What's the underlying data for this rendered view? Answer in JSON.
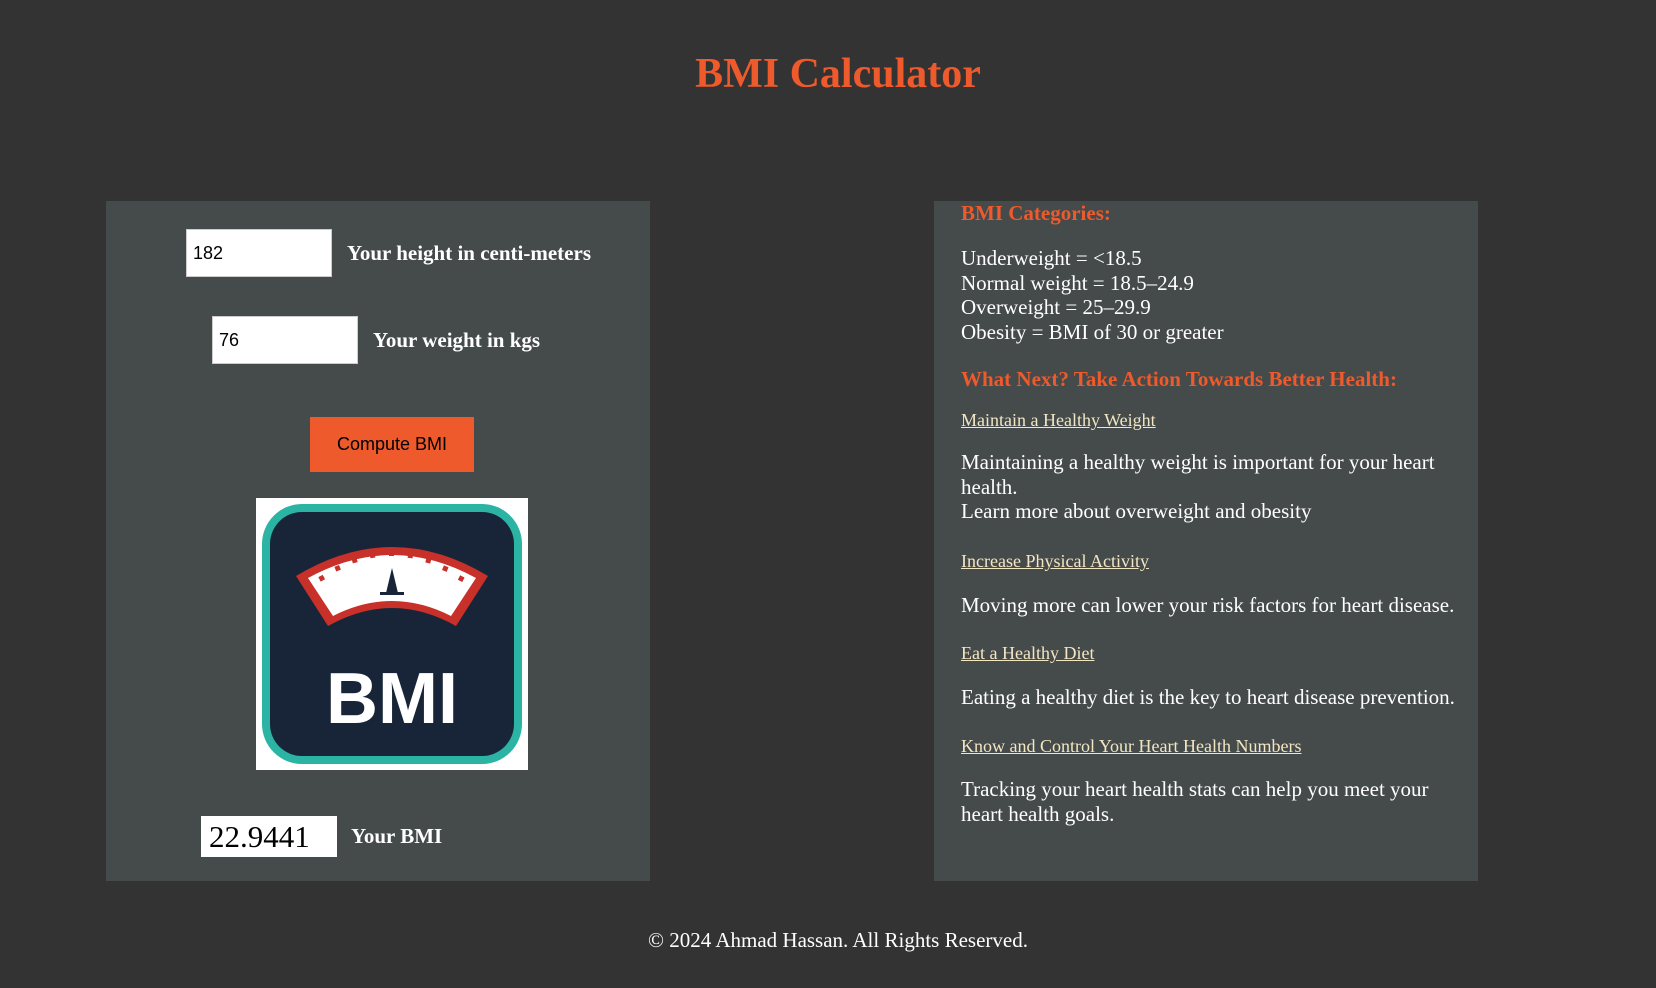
{
  "page": {
    "title": "BMI Calculator"
  },
  "calculator": {
    "height_value": "182",
    "height_label": "Your height in centi-meters",
    "weight_value": "76",
    "weight_label": "Your weight in kgs",
    "compute_label": "Compute BMI",
    "logo_text": "BMI",
    "result_value": "22.9441",
    "result_label": "Your BMI"
  },
  "info": {
    "categories_heading": "BMI Categories:",
    "categories": [
      "Underweight = <18.5",
      "Normal weight = 18.5–24.9",
      "Overweight = 25–29.9",
      "Obesity = BMI of 30 or greater"
    ],
    "actions_heading": "What Next? Take Action Towards Better Health:",
    "actions": [
      {
        "link": "Maintain a Healthy Weight",
        "desc": "Maintaining a healthy weight is important for your heart health.",
        "extra": "Learn more about overweight and obesity"
      },
      {
        "link": "Increase Physical Activity",
        "desc": "Moving more can lower your risk factors for heart disease."
      },
      {
        "link": "Eat a Healthy Diet",
        "desc": "Eating a healthy diet is the key to heart disease prevention."
      },
      {
        "link": "Know and Control Your Heart Health Numbers",
        "desc": "Tracking your heart health stats can help you meet your heart health goals."
      }
    ]
  },
  "footer": {
    "text": "© 2024 Ahmad Hassan. All Rights Reserved."
  },
  "colors": {
    "background": "#333333",
    "panel": "#454a4b",
    "accent": "#ee5a2b",
    "link": "#f3e6c3",
    "logo_teal": "#2bb3a3",
    "logo_navy": "#182538",
    "logo_red": "#c8302a"
  }
}
